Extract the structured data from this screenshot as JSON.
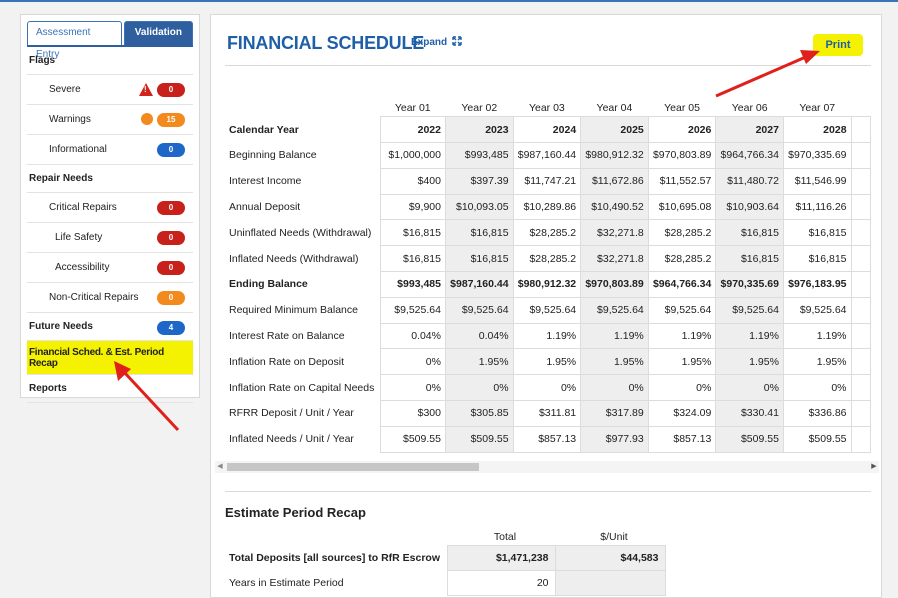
{
  "sidebar": {
    "tabs": [
      {
        "label": "Assessment Entry"
      },
      {
        "label": "Validation"
      }
    ],
    "flags": "Flags",
    "severe": {
      "label": "Severe",
      "count": "0"
    },
    "warnings": {
      "label": "Warnings",
      "count": "15"
    },
    "informational": {
      "label": "Informational",
      "count": "0"
    },
    "repair_needs": "Repair Needs",
    "critical": {
      "label": "Critical Repairs",
      "count": "0"
    },
    "life_safety": {
      "label": "Life Safety",
      "count": "0"
    },
    "accessibility": {
      "label": "Accessibility",
      "count": "0"
    },
    "non_critical": {
      "label": "Non-Critical Repairs",
      "count": "0"
    },
    "future": {
      "label": "Future Needs",
      "count": "4"
    },
    "fin_sched": "Financial Sched. & Est. Period Recap",
    "reports": "Reports"
  },
  "main": {
    "title": "FINANCIAL SCHEDULE",
    "expand": "Expand",
    "print": "Print"
  },
  "schedule": {
    "years": [
      "Year 01",
      "Year 02",
      "Year 03",
      "Year 04",
      "Year 05",
      "Year 06",
      "Year 07"
    ],
    "rows": [
      {
        "label": "Calendar Year",
        "bold": true,
        "values": [
          "2022",
          "2023",
          "2024",
          "2025",
          "2026",
          "2027",
          "2028"
        ]
      },
      {
        "label": "Beginning Balance",
        "values": [
          "$1,000,000",
          "$993,485",
          "$987,160.44",
          "$980,912.32",
          "$970,803.89",
          "$964,766.34",
          "$970,335.69"
        ]
      },
      {
        "label": "Interest Income",
        "values": [
          "$400",
          "$397.39",
          "$11,747.21",
          "$11,672.86",
          "$11,552.57",
          "$11,480.72",
          "$11,546.99"
        ]
      },
      {
        "label": "Annual Deposit",
        "values": [
          "$9,900",
          "$10,093.05",
          "$10,289.86",
          "$10,490.52",
          "$10,695.08",
          "$10,903.64",
          "$11,116.26"
        ]
      },
      {
        "label": "Uninflated Needs (Withdrawal)",
        "values": [
          "$16,815",
          "$16,815",
          "$28,285.2",
          "$32,271.8",
          "$28,285.2",
          "$16,815",
          "$16,815"
        ]
      },
      {
        "label": "Inflated Needs (Withdrawal)",
        "values": [
          "$16,815",
          "$16,815",
          "$28,285.2",
          "$32,271.8",
          "$28,285.2",
          "$16,815",
          "$16,815"
        ]
      },
      {
        "label": "Ending Balance",
        "bold": true,
        "values": [
          "$993,485",
          "$987,160.44",
          "$980,912.32",
          "$970,803.89",
          "$964,766.34",
          "$970,335.69",
          "$976,183.95"
        ]
      },
      {
        "label": "Required Minimum Balance",
        "values": [
          "$9,525.64",
          "$9,525.64",
          "$9,525.64",
          "$9,525.64",
          "$9,525.64",
          "$9,525.64",
          "$9,525.64"
        ]
      },
      {
        "label": "Interest Rate on Balance",
        "values": [
          "0.04%",
          "0.04%",
          "1.19%",
          "1.19%",
          "1.19%",
          "1.19%",
          "1.19%"
        ]
      },
      {
        "label": "Inflation Rate on Deposit",
        "values": [
          "0%",
          "1.95%",
          "1.95%",
          "1.95%",
          "1.95%",
          "1.95%",
          "1.95%"
        ]
      },
      {
        "label": "Inflation Rate on Capital Needs",
        "values": [
          "0%",
          "0%",
          "0%",
          "0%",
          "0%",
          "0%",
          "0%"
        ]
      },
      {
        "label": "RFRR Deposit / Unit / Year",
        "values": [
          "$300",
          "$305.85",
          "$311.81",
          "$317.89",
          "$324.09",
          "$330.41",
          "$336.86"
        ]
      },
      {
        "label": "Inflated Needs / Unit / Year",
        "values": [
          "$509.55",
          "$509.55",
          "$857.13",
          "$977.93",
          "$857.13",
          "$509.55",
          "$509.55"
        ]
      }
    ]
  },
  "recap": {
    "title": "Estimate Period Recap",
    "col_total": "Total",
    "col_unit": "$/Unit",
    "rows": [
      {
        "label": "Total Deposits [all sources] to RfR Escrow",
        "total": "$1,471,238",
        "unit": "$44,583"
      },
      {
        "label": "Years in Estimate Period",
        "total": "20",
        "unit": ""
      }
    ]
  },
  "colors": {
    "accent": "#1f5fa8",
    "highlight": "#f4f200",
    "badge_red": "#c8201b",
    "badge_orange": "#f28a1e",
    "badge_blue": "#1e67c9",
    "arrow": "#e0201a"
  }
}
